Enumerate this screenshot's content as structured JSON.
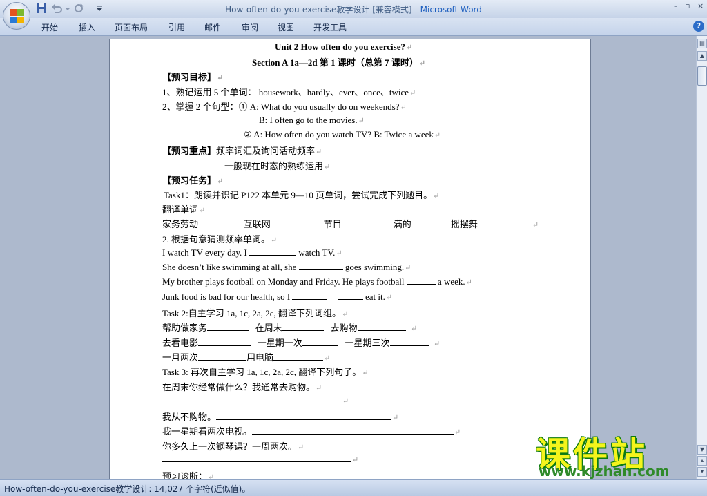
{
  "window": {
    "doc_name": "How-often-do-you-exercise教学设计",
    "mode": "[兼容模式]",
    "separator": "-",
    "app": "Microsoft Word",
    "min_glyph": "–",
    "restore_glyph": "▫",
    "close_glyph": "×"
  },
  "ribbon": {
    "tabs": [
      "开始",
      "插入",
      "页面布局",
      "引用",
      "邮件",
      "审阅",
      "视图",
      "开发工具"
    ],
    "help": "?"
  },
  "document": {
    "title": "Unit 2    How often do you exercise?",
    "subtitle": "Section A 1a—2d    第 1 课时（总第 7 课时）",
    "goals_head": "【预习目标】",
    "goal1": "1、熟记运用 5 个单词：  housework、hardly、ever、once、twice",
    "goal2": "2、掌握 2 个句型：① A: What do you usually do on weekends?",
    "goal2b": "B: I often go to the movies.",
    "goal2c": "②  A: How often do you watch TV?        B: Twice a week",
    "focus_head": "【预习重点】",
    "focus1": "频率词汇及询问活动频率",
    "focus2": "一般现在时态的熟练运用",
    "task_head": "【预习任务】",
    "task1": " Task1：朗读并识记 P122  本单元 9—10 页单词，尝试完成下列题目。",
    "translate_head": "翻译单词",
    "words": [
      "家务劳动",
      "互联网",
      "节目",
      "满的",
      "摇摆舞"
    ],
    "guess_head": "2.  根据句意猜测频率单词。",
    "s1a": "I watch TV every day. I ",
    "s1b": " watch TV.",
    "s2a": "She doesn’t like swimming at all, she ",
    "s2b": " goes swimming.",
    "s3a": "My brother plays football on Monday and Friday. He plays football ",
    "s3b": " a week.",
    "s4a": "Junk food is bad for our health, so I ",
    "s4b": " eat it.",
    "task2": "Task 2:自主学习 1a, 1c, 2a, 2c,  翻译下列词组。",
    "phr1": [
      "帮助做家务",
      "在周末",
      "去购物"
    ],
    "phr2": [
      "去看电影",
      "一星期一次",
      "一星期三次"
    ],
    "phr3": [
      "一月两次",
      "用电脑"
    ],
    "task3": "Task 3:  再次自主学习 1a, 1c, 2a, 2c,  翻译下列句子。",
    "q1": "在周末你经常做什么？我通常去购物。",
    "q2": "我从不购物。",
    "q3": "我一星期看两次电视。",
    "q4": "你多久上一次钢琴课？一周两次。",
    "diag": "预习诊断：",
    "para_mark": "↵"
  },
  "status": {
    "text": "How-often-do-you-exercise教学设计: 14,027 个字符(近似值)。"
  },
  "watermark": {
    "main": "课件站",
    "url": "www.kjzhan.com"
  },
  "colors": {
    "title_text": "#3e5b82",
    "app_name": "#1e5fbf",
    "workspace": "#adb9cd",
    "watermark_yellow": "#f4f41c",
    "watermark_green": "#0c7a12"
  }
}
